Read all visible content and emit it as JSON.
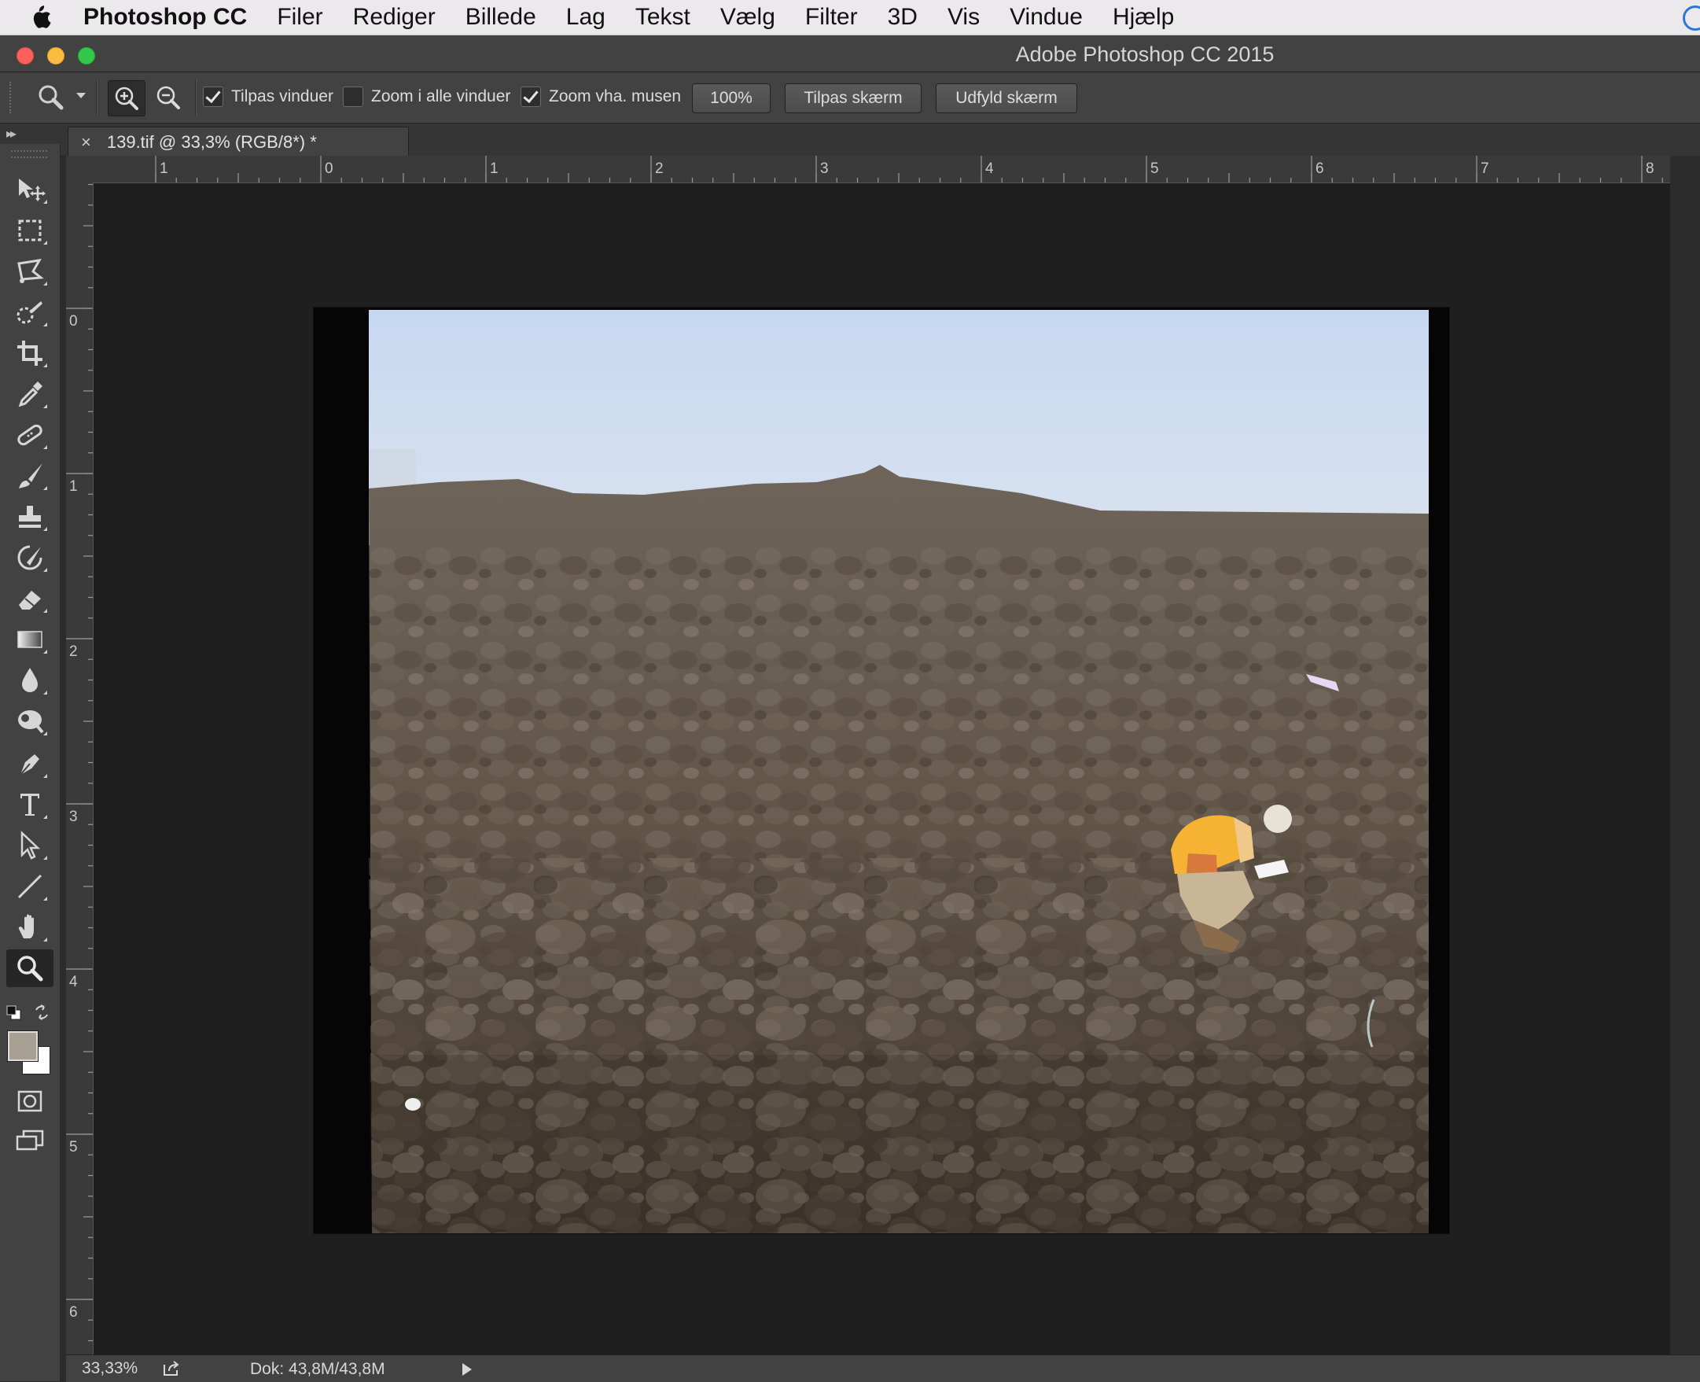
{
  "menubar": {
    "app_name": "Photoshop CC",
    "items": [
      "Filer",
      "Rediger",
      "Billede",
      "Lag",
      "Tekst",
      "Vælg",
      "Filter",
      "3D",
      "Vis",
      "Vindue",
      "Hjælp"
    ]
  },
  "window": {
    "title": "Adobe Photoshop CC 2015"
  },
  "options": {
    "resize_windows": {
      "label": "Tilpas vinduer",
      "checked": true
    },
    "zoom_all_windows": {
      "label": "Zoom i alle vinduer",
      "checked": false
    },
    "scrubby_zoom": {
      "label": "Zoom vha. musen",
      "checked": true
    },
    "btn_100": "100%",
    "btn_fit": "Tilpas skærm",
    "btn_fill": "Udfyld skærm"
  },
  "document": {
    "tab_title": "139.tif @ 33,3% (RGB/8*) *",
    "close_glyph": "×"
  },
  "rulers": {
    "horizontal": [
      "1",
      "0",
      "1",
      "2",
      "3",
      "4",
      "5",
      "6",
      "7",
      "8"
    ],
    "vertical": [
      "0",
      "1",
      "2",
      "3",
      "4",
      "5",
      "6"
    ]
  },
  "tools": [
    {
      "name": "move-tool",
      "icon": "move-icon"
    },
    {
      "name": "marquee-tool",
      "icon": "marquee-icon"
    },
    {
      "name": "lasso-tool",
      "icon": "polygonal-lasso-icon"
    },
    {
      "name": "quick-selection-tool",
      "icon": "quick-selection-icon"
    },
    {
      "name": "crop-tool",
      "icon": "crop-icon"
    },
    {
      "name": "eyedropper-tool",
      "icon": "eyedropper-icon"
    },
    {
      "name": "healing-brush-tool",
      "icon": "bandage-icon"
    },
    {
      "name": "brush-tool",
      "icon": "brush-icon"
    },
    {
      "name": "clone-stamp-tool",
      "icon": "stamp-icon"
    },
    {
      "name": "history-brush-tool",
      "icon": "history-brush-icon"
    },
    {
      "name": "eraser-tool",
      "icon": "eraser-icon"
    },
    {
      "name": "gradient-tool",
      "icon": "gradient-icon"
    },
    {
      "name": "blur-tool",
      "icon": "droplet-icon"
    },
    {
      "name": "dodge-tool",
      "icon": "dodge-icon"
    },
    {
      "name": "pen-tool",
      "icon": "pen-icon"
    },
    {
      "name": "type-tool",
      "icon": "type-icon"
    },
    {
      "name": "path-selection-tool",
      "icon": "arrow-icon"
    },
    {
      "name": "line-tool",
      "icon": "line-icon"
    },
    {
      "name": "hand-tool",
      "icon": "hand-icon"
    },
    {
      "name": "zoom-tool",
      "icon": "magnifier-icon",
      "active": true
    }
  ],
  "colors": {
    "foreground": "#a8a093",
    "background": "#ffffff"
  },
  "status": {
    "zoom": "33,33%",
    "doc": "Dok: 43,8M/43,8M"
  }
}
